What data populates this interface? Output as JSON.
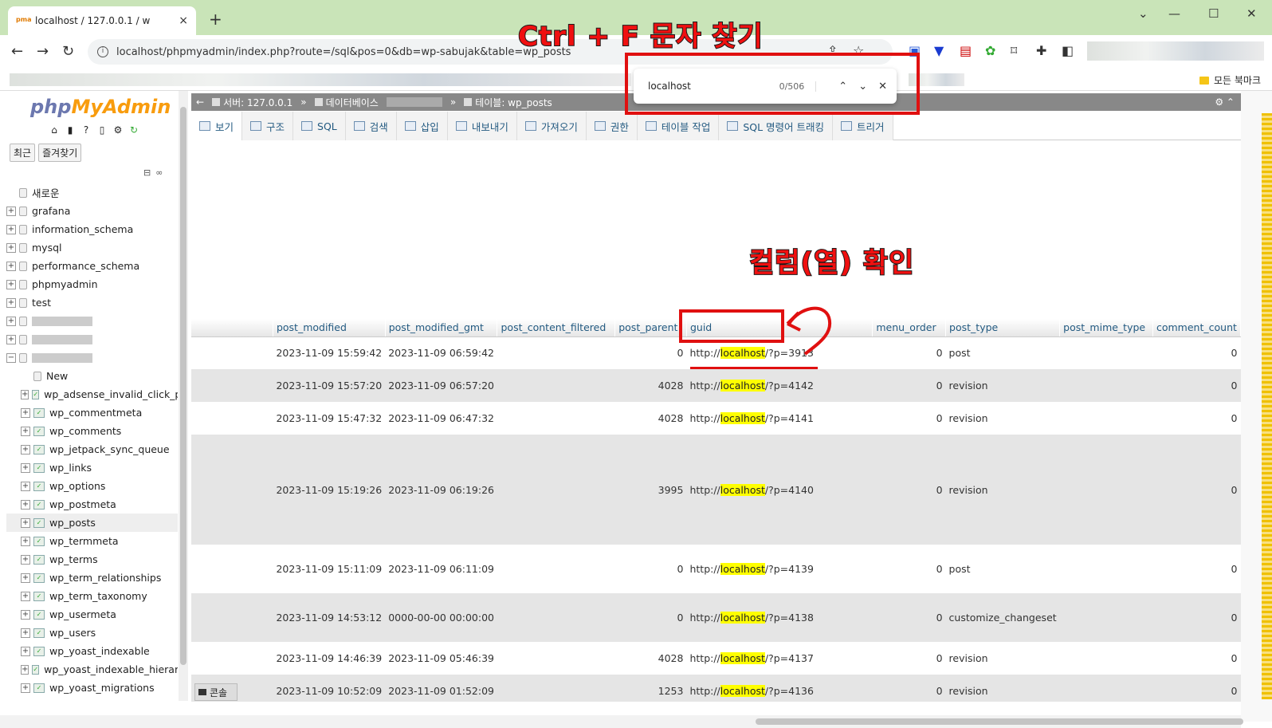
{
  "browser": {
    "tab_title": "localhost / 127.0.0.1 / w",
    "tab_close": "×",
    "new_tab": "+",
    "url": "localhost/phpmyadmin/index.php?route=/sql&pos=0&db=wp-sabujak&table=wp_posts",
    "bookmarks_all": "모든 북마크",
    "icons": [
      "back-icon",
      "forward-icon",
      "reload-icon",
      "info-icon",
      "extensions-icon",
      "bookmark-icon",
      "star-icon",
      "share-icon"
    ]
  },
  "find": {
    "query": "localhost",
    "count": "0/506"
  },
  "pma": {
    "logo_php": "php",
    "logo_my": "MyAdmin",
    "nav_recent": "최근",
    "nav_fav": "즐겨찾기",
    "tree": [
      {
        "label": "새로운",
        "type": "new"
      },
      {
        "label": "grafana",
        "type": "db"
      },
      {
        "label": "information_schema",
        "type": "db"
      },
      {
        "label": "mysql",
        "type": "db"
      },
      {
        "label": "performance_schema",
        "type": "db"
      },
      {
        "label": "phpmyadmin",
        "type": "db"
      },
      {
        "label": "test",
        "type": "db"
      },
      {
        "label": "",
        "type": "redacted"
      },
      {
        "label": "",
        "type": "redacted"
      },
      {
        "label": "",
        "type": "redacted-open"
      },
      {
        "label": "New",
        "type": "child-new"
      },
      {
        "label": "wp_adsense_invalid_click_p",
        "type": "table"
      },
      {
        "label": "wp_commentmeta",
        "type": "table"
      },
      {
        "label": "wp_comments",
        "type": "table"
      },
      {
        "label": "wp_jetpack_sync_queue",
        "type": "table"
      },
      {
        "label": "wp_links",
        "type": "table"
      },
      {
        "label": "wp_options",
        "type": "table"
      },
      {
        "label": "wp_postmeta",
        "type": "table"
      },
      {
        "label": "wp_posts",
        "type": "table-selected"
      },
      {
        "label": "wp_termmeta",
        "type": "table"
      },
      {
        "label": "wp_terms",
        "type": "table"
      },
      {
        "label": "wp_term_relationships",
        "type": "table"
      },
      {
        "label": "wp_term_taxonomy",
        "type": "table"
      },
      {
        "label": "wp_usermeta",
        "type": "table"
      },
      {
        "label": "wp_users",
        "type": "table"
      },
      {
        "label": "wp_yoast_indexable",
        "type": "table"
      },
      {
        "label": "wp_yoast_indexable_hierar",
        "type": "table"
      },
      {
        "label": "wp_yoast_migrations",
        "type": "table"
      }
    ],
    "breadcrumb": {
      "server": "서버: 127.0.0.1",
      "sep": "»",
      "database": "데이터베이스",
      "table": "테이블: wp_posts"
    },
    "tabs": [
      "보기",
      "구조",
      "SQL",
      "검색",
      "삽입",
      "내보내기",
      "가져오기",
      "권한",
      "테이블 작업",
      "SQL 명령어 트래킹",
      "트리거"
    ],
    "console": "콘솔",
    "columns": [
      "post_modified",
      "post_modified_gmt",
      "post_content_filtered",
      "post_parent",
      "guid",
      "menu_order",
      "post_type",
      "post_mime_type",
      "comment_count"
    ],
    "rows": [
      {
        "modified": "2023-11-09 15:59:42",
        "modified_gmt": "2023-11-09 06:59:42",
        "parent": "0",
        "guid_pre": "http://",
        "guid_hl": "localhost",
        "guid_post": "/?p=3913",
        "menu_order": "0",
        "type": "post",
        "comments": "0"
      },
      {
        "modified": "2023-11-09 15:57:20",
        "modified_gmt": "2023-11-09 06:57:20",
        "parent": "4028",
        "guid_pre": "http://",
        "guid_hl": "localhost",
        "guid_post": "/?p=4142",
        "menu_order": "0",
        "type": "revision",
        "comments": "0"
      },
      {
        "modified": "2023-11-09 15:47:32",
        "modified_gmt": "2023-11-09 06:47:32",
        "parent": "4028",
        "guid_pre": "http://",
        "guid_hl": "localhost",
        "guid_post": "/?p=4141",
        "menu_order": "0",
        "type": "revision",
        "comments": "0"
      },
      {
        "modified": "2023-11-09 15:19:26",
        "modified_gmt": "2023-11-09 06:19:26",
        "parent": "3995",
        "guid_pre": "http://",
        "guid_hl": "localhost",
        "guid_post": "/?p=4140",
        "menu_order": "0",
        "type": "revision",
        "comments": "0"
      },
      {
        "modified": "2023-11-09 15:11:09",
        "modified_gmt": "2023-11-09 06:11:09",
        "parent": "0",
        "guid_pre": "http://",
        "guid_hl": "localhost",
        "guid_post": "/?p=4139",
        "menu_order": "0",
        "type": "post",
        "comments": "0"
      },
      {
        "modified": "2023-11-09 14:53:12",
        "modified_gmt": "0000-00-00 00:00:00",
        "parent": "0",
        "guid_pre": "http://",
        "guid_hl": "localhost",
        "guid_post": "/?p=4138",
        "menu_order": "0",
        "type": "customize_changeset",
        "comments": "0"
      },
      {
        "modified": "2023-11-09 14:46:39",
        "modified_gmt": "2023-11-09 05:46:39",
        "parent": "4028",
        "guid_pre": "http://",
        "guid_hl": "localhost",
        "guid_post": "/?p=4137",
        "menu_order": "0",
        "type": "revision",
        "comments": "0"
      },
      {
        "modified": "2023-11-09 10:52:09",
        "modified_gmt": "2023-11-09 01:52:09",
        "parent": "1253",
        "guid_pre": "http://",
        "guid_hl": "localhost",
        "guid_post": "/?p=4136",
        "menu_order": "0",
        "type": "revision",
        "comments": "0"
      }
    ]
  },
  "annotations": {
    "find_caption": "Ctrl + F  문자 찾기",
    "column_caption": "컬럼(열) 확인",
    "color": "#e01010"
  }
}
